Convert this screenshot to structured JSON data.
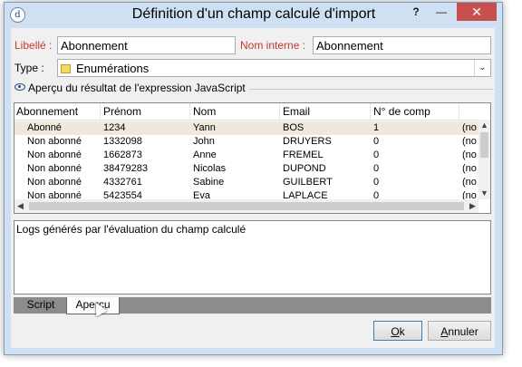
{
  "window": {
    "title": "Définition d'un champ calculé d'import",
    "help_label": "?",
    "minimize_label": "—",
    "close_label": "✕",
    "icon": "app-logo-icon",
    "icon_glyph": "d"
  },
  "form": {
    "libelle_label": "Libellé :",
    "libelle_value": "Abonnement",
    "nom_interne_label": "Nom interne :",
    "nom_interne_value": "Abonnement",
    "type_label": "Type :",
    "type_value": "Enumérations",
    "type_icon": "enumeration-icon"
  },
  "preview": {
    "section_title": "Aperçu du résultat de l'expression JavaScript",
    "section_icon": "eye-icon",
    "columns": [
      "Abonnement",
      "Prénom",
      "Nom",
      "Email",
      "N° de comp"
    ],
    "rows": [
      [
        "Abonné",
        "1234",
        "Yann",
        "BOS",
        "1",
        "(no"
      ],
      [
        "Non abonné",
        "1332098",
        "John",
        "DRUYERS",
        "0",
        "(no"
      ],
      [
        "Non abonné",
        "1662873",
        "Anne",
        "FREMEL",
        "0",
        "(no"
      ],
      [
        "Non abonné",
        "38479283",
        "Nicolas",
        "DUPOND",
        "0",
        "(no"
      ],
      [
        "Non abonné",
        "4332761",
        "Sabine",
        "GUILBERT",
        "0",
        "(no"
      ],
      [
        "Non abonné",
        "5423554",
        "Eva",
        "LAPLACE",
        "0",
        "(no"
      ]
    ],
    "selected_row": 0
  },
  "logs": {
    "title": "Logs générés par l'évaluation du champ calculé"
  },
  "tabs": [
    {
      "label": "Script"
    },
    {
      "label": "Aperçu"
    }
  ],
  "buttons": {
    "ok_prefix": "",
    "ok_underlined": "O",
    "ok_rest": "k",
    "cancel_prefix": "",
    "cancel_underlined": "A",
    "cancel_rest": "nnuler"
  }
}
